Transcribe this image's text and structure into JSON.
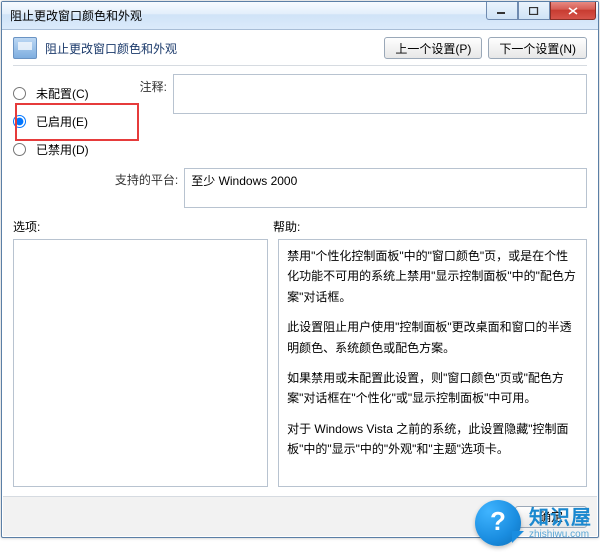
{
  "titlebar": {
    "title": "阻止更改窗口颜色和外观"
  },
  "header": {
    "title": "阻止更改窗口颜色和外观"
  },
  "nav": {
    "prev": "上一个设置(P)",
    "next": "下一个设置(N)"
  },
  "radios": {
    "not_configured": "未配置(C)",
    "enabled": "已启用(E)",
    "disabled": "已禁用(D)",
    "selected": "enabled"
  },
  "labels": {
    "comment": "注释:",
    "platform": "支持的平台:",
    "options": "选项:",
    "help": "帮助:"
  },
  "fields": {
    "comment_value": "",
    "platform_value": "至少 Windows 2000"
  },
  "help_paragraphs": [
    "禁用\"个性化控制面板\"中的\"窗口颜色\"页，或是在个性化功能不可用的系统上禁用\"显示控制面板\"中的\"配色方案\"对话框。",
    "此设置阻止用户使用\"控制面板\"更改桌面和窗口的半透明颜色、系统颜色或配色方案。",
    "如果禁用或未配置此设置，则\"窗口颜色\"页或\"配色方案\"对话框在\"个性化\"或\"显示控制面板\"中可用。",
    "对于 Windows Vista 之前的系统，此设置隐藏\"控制面板\"中的\"显示\"中的\"外观\"和\"主题\"选项卡。"
  ],
  "footer": {
    "ok": "确定"
  },
  "watermark": {
    "name": "知识屋",
    "url": "zhishiwu.com"
  }
}
